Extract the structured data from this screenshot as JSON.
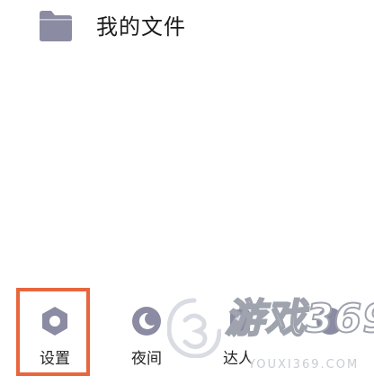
{
  "menu": {
    "my_files_label": "我的文件",
    "my_files_icon": "folder-icon"
  },
  "toolbar": {
    "settings_label": "设置",
    "settings_icon": "gear-hex-icon",
    "night_label": "夜间",
    "night_icon": "moon-icon",
    "expert_label": "达人",
    "expert_icon": "badge-icon",
    "fourth_icon": "circle-icon"
  },
  "watermark": {
    "brand": "游戏369",
    "url": "YOUXI369.COM"
  },
  "colors": {
    "icon": "#8b8ba3",
    "highlight": "#e8663d",
    "text": "#222222"
  }
}
